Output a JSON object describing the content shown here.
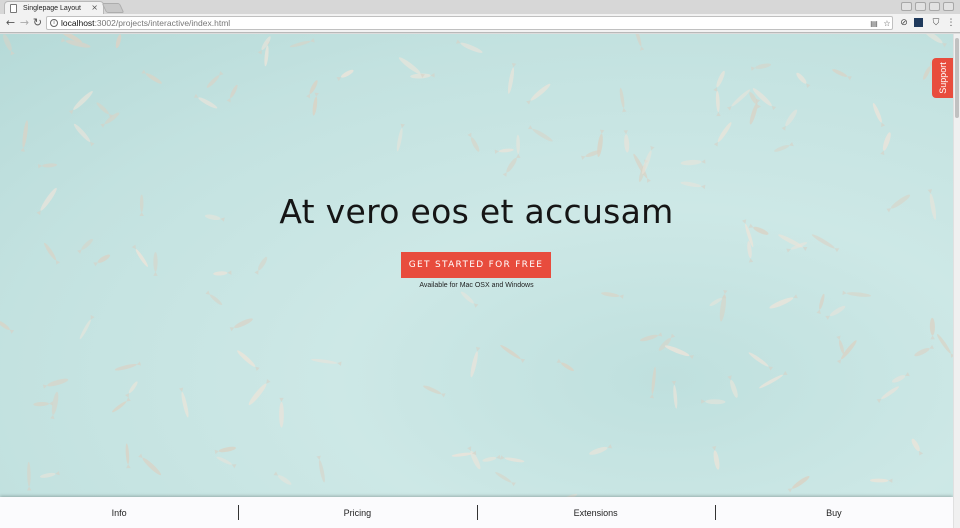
{
  "browser": {
    "tab_title": "Singlepage Layout",
    "tab_close": "×",
    "url_host": "localhost",
    "url_path": ":3002/projects/interactive/index.html",
    "back_glyph": "←",
    "forward_glyph": "→",
    "reload_glyph": "↻",
    "menu_glyph": "⋮"
  },
  "hero": {
    "heading": "At vero eos et accusam",
    "cta_label": "GET STARTED FOR FREE",
    "availability": "Available for Mac OSX and Windows",
    "support_label": "Support"
  },
  "bottom_nav": {
    "items": [
      "Info",
      "Pricing",
      "Extensions",
      "Buy"
    ]
  },
  "colors": {
    "accent": "#e84c3d",
    "hero_bg": "#c6e4e2",
    "nav_bg": "#fbfbfd"
  },
  "icons": {
    "tab": "document-icon",
    "info": "info-icon",
    "translate": "translate-icon",
    "bookmark": "star-icon",
    "extensions": [
      "block-icon",
      "dark-square-icon",
      "shield-icon"
    ]
  }
}
